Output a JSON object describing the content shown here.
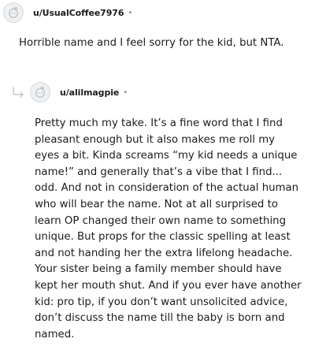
{
  "comments": [
    {
      "username": "u/UsualCoffee7976",
      "separator": "•",
      "avatar_icon": "snoo-avatar-icon",
      "body": "Horrible name and I feel sorry for the kid, but NTA."
    },
    {
      "username": "u/alilmagpie",
      "separator": "•",
      "avatar_icon": "snoo-avatar-icon",
      "reply_icon": "reply-arrow-icon",
      "body": "Pretty much my take. It’s a fine word that I find pleasant enough but it also makes me roll my eyes a bit. Kinda screams “my kid needs a unique name!” and generally that’s a vibe that I find... odd. And not in consideration of the actual human who will bear the name. Not at all surprised to learn OP changed their own name to something unique. But props for the classic spelling at least and not handing her the extra lifelong headache. Your sister being a family member should have kept her mouth shut. And if you ever have another kid: pro tip, if you don’t want unsolicited advice, don’t discuss the name till the baby is born and named."
    }
  ],
  "colors": {
    "text": "#1c1c1c",
    "muted": "#878a8c",
    "avatar_bg": "#eef0f2"
  }
}
